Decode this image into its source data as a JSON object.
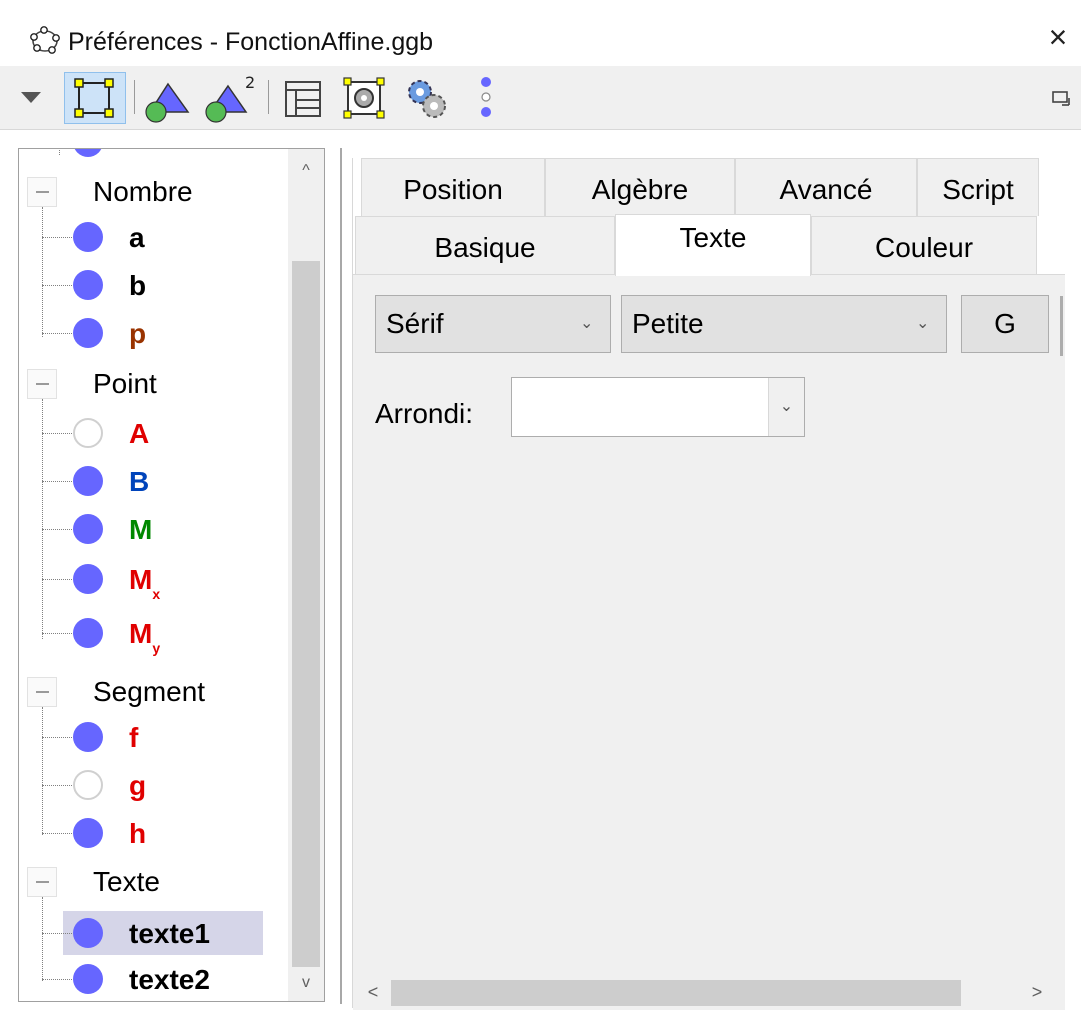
{
  "window": {
    "title": "Préférences - FonctionAffine.ggb",
    "app_icon": "geogebra-icon",
    "close_label": "×"
  },
  "toolbar": {
    "icons": [
      "dropdown-arrow-icon",
      "graphics-view-icon",
      "graphics-view-triangle-icon",
      "graphics-3d-view-icon",
      "layout-icon",
      "defaults-icon",
      "settings-icon",
      "more-options-icon",
      "dock-icon"
    ]
  },
  "tree": {
    "groups": [
      {
        "label": "Nombre",
        "items": [
          {
            "label": "a",
            "color": "#000000",
            "hollow": false
          },
          {
            "label": "b",
            "color": "#000000",
            "hollow": false
          },
          {
            "label": "p",
            "color": "#993300",
            "hollow": false
          }
        ]
      },
      {
        "label": "Point",
        "items": [
          {
            "label": "A",
            "color": "#e00000",
            "hollow": true
          },
          {
            "label": "B",
            "color": "#0044bb",
            "hollow": false
          },
          {
            "label": "M",
            "color": "#008800",
            "hollow": false
          },
          {
            "label": "M",
            "sub": "x",
            "color": "#e00000",
            "hollow": false
          },
          {
            "label": "M",
            "sub": "y",
            "color": "#e00000",
            "hollow": false
          }
        ]
      },
      {
        "label": "Segment",
        "items": [
          {
            "label": "f",
            "color": "#e00000",
            "hollow": false
          },
          {
            "label": "g",
            "color": "#e00000",
            "hollow": true
          },
          {
            "label": "h",
            "color": "#e00000",
            "hollow": false
          }
        ]
      },
      {
        "label": "Texte",
        "items": [
          {
            "label": "texte1",
            "color": "#000000",
            "hollow": false,
            "selected": true
          },
          {
            "label": "texte2",
            "color": "#000000",
            "hollow": false
          }
        ]
      }
    ],
    "scroll_up": "^",
    "scroll_down": "v"
  },
  "tabs": {
    "row1": [
      "Position",
      "Algèbre",
      "Avancé",
      "Script"
    ],
    "row2": [
      "Basique",
      "Texte",
      "Couleur"
    ],
    "active": "Texte"
  },
  "text_tab": {
    "font_family": "Sérif",
    "font_size": "Petite",
    "bold_button": "G",
    "rounding_label": "Arrondi:",
    "rounding_value": ""
  },
  "hscroll": {
    "left": "<",
    "right": ">"
  }
}
